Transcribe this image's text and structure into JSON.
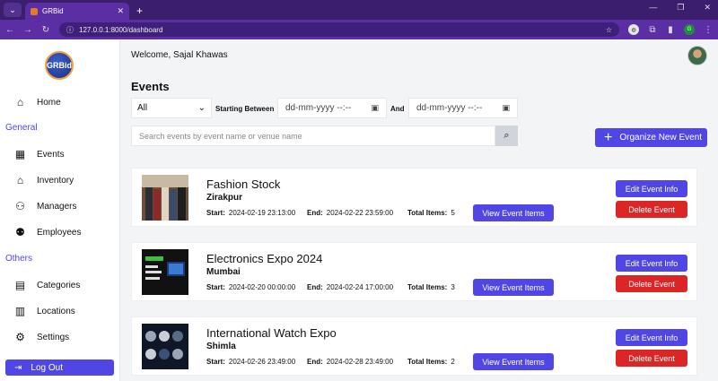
{
  "browser": {
    "tab_title": "GRBid",
    "url": "127.0.0.1:8000/dashboard",
    "ext_label": "G"
  },
  "sidebar": {
    "logo": "GRBid",
    "items": [
      {
        "label": "Home",
        "icon": "home-icon"
      },
      {
        "label": "Events",
        "icon": "calendar-icon"
      },
      {
        "label": "Inventory",
        "icon": "inventory-icon"
      },
      {
        "label": "Managers",
        "icon": "manager-icon"
      },
      {
        "label": "Employees",
        "icon": "employees-icon"
      },
      {
        "label": "Categories",
        "icon": "categories-icon"
      },
      {
        "label": "Locations",
        "icon": "building-icon"
      },
      {
        "label": "Settings",
        "icon": "gear-icon"
      }
    ],
    "sections": {
      "general": "General",
      "others": "Others"
    },
    "logout": "Log Out"
  },
  "header": {
    "welcome": "Welcome, Sajal Khawas"
  },
  "events": {
    "title": "Events",
    "filter": {
      "selected": "All",
      "starting_label": "Starting Between",
      "and_label": "And",
      "date_placeholder": "dd-mm-yyyy --:--"
    },
    "search_placeholder": "Search events by event name or venue name",
    "organize_label": "Organize New Event",
    "labels": {
      "start": "Start:",
      "end": "End:",
      "total": "Total Items:",
      "view": "View Event Items",
      "edit": "Edit Event Info",
      "delete": "Delete Event"
    },
    "list": [
      {
        "name": "Fashion Stock",
        "venue": "Zirakpur",
        "start": "2024-02-19 23:13:00",
        "end": "2024-02-22 23:59:00",
        "total": "5"
      },
      {
        "name": "Electronics Expo 2024",
        "venue": "Mumbai",
        "start": "2024-02-20 00:00:00",
        "end": "2024-02-24 17:00:00",
        "total": "3"
      },
      {
        "name": "International Watch Expo",
        "venue": "Shimla",
        "start": "2024-02-26 23:49:00",
        "end": "2024-02-28 23:49:00",
        "total": "2"
      }
    ]
  },
  "colors": {
    "primary": "#4f46e5",
    "danger": "#dc2626",
    "browser": "#5b2fa3"
  }
}
